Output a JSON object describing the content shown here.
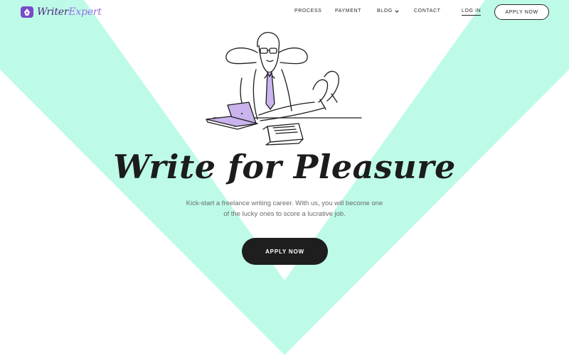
{
  "brand": {
    "name_part1": "Writer",
    "name_part2": "Expert"
  },
  "nav": {
    "links": [
      "PROCESS",
      "PAYMENT",
      "BLOG",
      "CONTACT"
    ],
    "login": "LOG IN",
    "apply": "APPLY NOW"
  },
  "hero": {
    "headline": "Write for Pleasure",
    "subtext": "Kick-start a freelance writing career. With us, you will become one of the lucky ones to score a lucrative job.",
    "cta": "APPLY NOW"
  },
  "colors": {
    "mint": "#bdfbe8",
    "accent_purple": "#9f6ee6",
    "dark": "#1e1e1e"
  }
}
